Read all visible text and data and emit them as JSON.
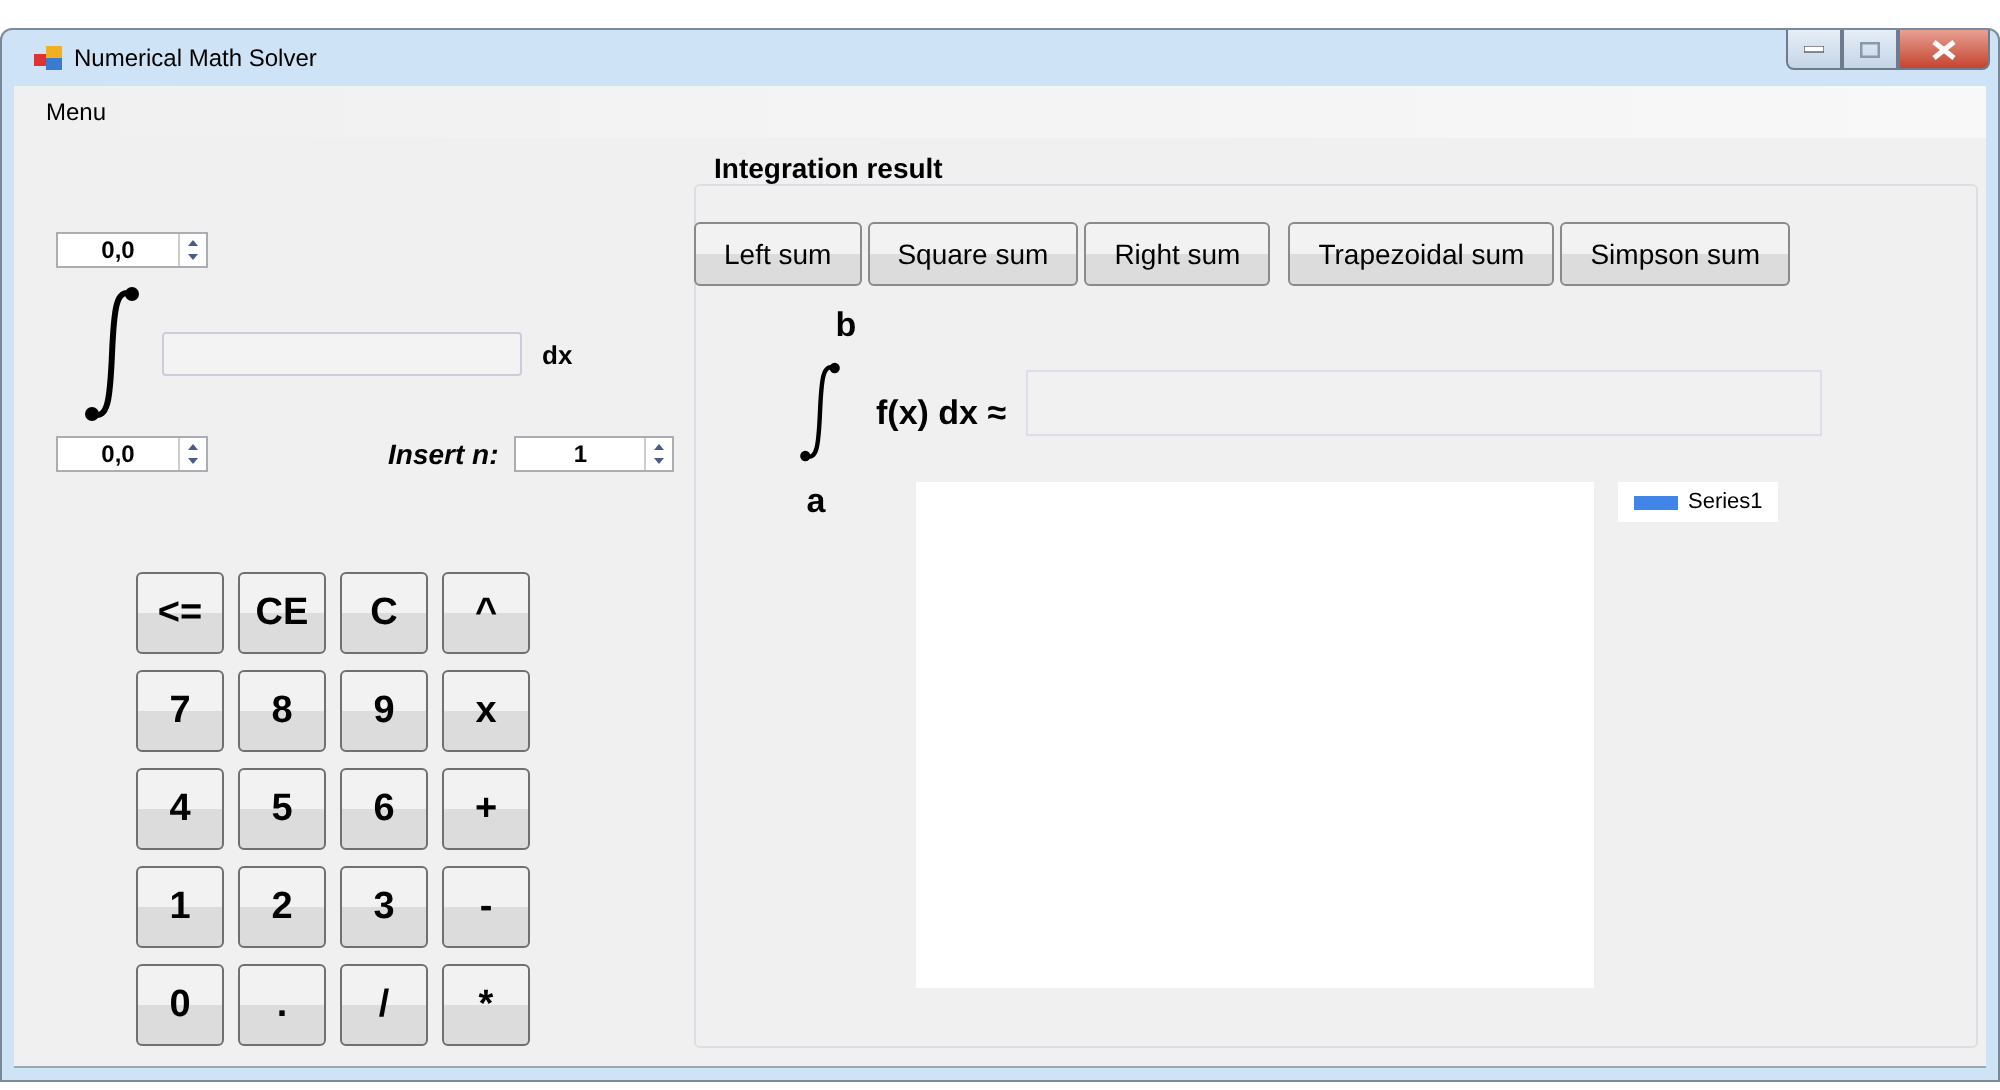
{
  "window": {
    "title": "Numerical Math Solver"
  },
  "menu": [
    "Menu"
  ],
  "integral": {
    "upper": "0,0",
    "lower": "0,0",
    "suffix": "dx",
    "n_label": "Insert n:",
    "n_value": "1"
  },
  "keypad": [
    [
      "<=",
      "CE",
      "C",
      "^"
    ],
    [
      "7",
      "8",
      "9",
      "x"
    ],
    [
      "4",
      "5",
      "6",
      "+"
    ],
    [
      "1",
      "2",
      "3",
      "-"
    ],
    [
      "0",
      ".",
      "/",
      "*"
    ]
  ],
  "result": {
    "title": "Integration result",
    "methods": [
      "Left sum",
      "Square sum",
      "Right sum",
      "Trapezoidal sum",
      "Simpson sum"
    ],
    "upper": "b",
    "lower": "a",
    "expression": "f(x) dx ≈",
    "legend": [
      "Series1"
    ]
  }
}
